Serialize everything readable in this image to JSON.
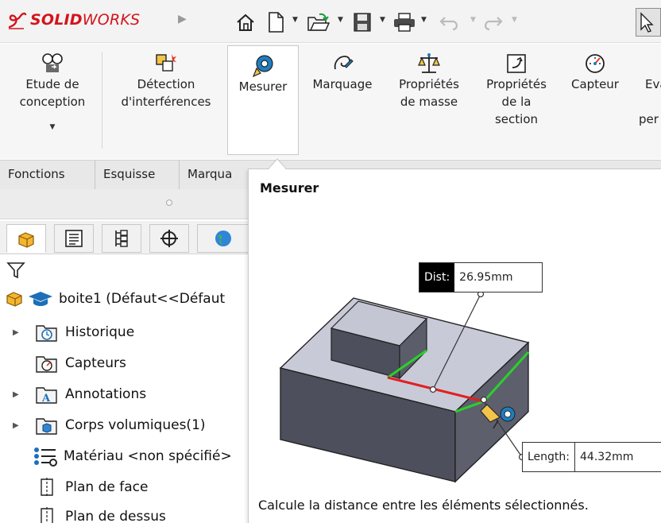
{
  "app": {
    "logo_prefix": "SOLID",
    "logo_suffix": "WORKS",
    "brand_color": "#d3141c"
  },
  "quick_access": {
    "items": [
      "home-icon",
      "new-document-icon",
      "open-folder-icon",
      "save-icon",
      "print-icon",
      "undo-icon",
      "redo-icon",
      "select-pointer-icon"
    ]
  },
  "ribbon": {
    "buttons": [
      {
        "label": "Etude de conception",
        "icon": "design-study-icon"
      },
      {
        "label": "Détection d'interférences",
        "icon": "interference-detection-icon"
      },
      {
        "label": "Mesurer",
        "icon": "measure-tape-icon",
        "active": true
      },
      {
        "label": "Marquage",
        "icon": "markup-icon"
      },
      {
        "label": "Propriétés de masse",
        "icon": "balance-scale-icon"
      },
      {
        "label": "Propriétés de la section",
        "icon": "section-properties-icon"
      },
      {
        "label": "Capteur",
        "icon": "sensor-gauge-icon"
      },
      {
        "label": "Eva",
        "label_line3": "per",
        "icon": "evaluate-icon"
      }
    ]
  },
  "tabs": [
    {
      "label": "Fonctions"
    },
    {
      "label": "Esquisse"
    },
    {
      "label": "Marqua"
    }
  ],
  "feature_manager": {
    "panel_tabs": [
      "feature-tree-icon",
      "property-manager-icon",
      "configuration-manager-icon",
      "dimxpert-icon",
      "display-manager-icon"
    ],
    "filter_icon": "filter-funnel-icon",
    "root": {
      "label": "boite1  (Défaut<<Défaut"
    },
    "nodes": [
      {
        "label": "Historique",
        "expandable": true,
        "icon": "history-icon"
      },
      {
        "label": "Capteurs",
        "expandable": false,
        "icon": "sensors-icon"
      },
      {
        "label": "Annotations",
        "expandable": true,
        "icon": "annotations-icon"
      },
      {
        "label": "Corps volumiques(1)",
        "expandable": true,
        "icon": "solid-bodies-icon"
      },
      {
        "label": "Matériau <non spécifié>",
        "expandable": false,
        "icon": "material-icon"
      },
      {
        "label": "Plan de face",
        "expandable": false,
        "icon": "plane-icon"
      },
      {
        "label": "Plan de dessus",
        "expandable": false,
        "icon": "plane-icon"
      }
    ]
  },
  "tooltip": {
    "title": "Mesurer",
    "dist_key": "Dist:",
    "dist_value": "26.95mm",
    "length_key": "Length:",
    "length_value": "44.32mm",
    "description": "Calcule la distance entre les éléments sélectionnés."
  }
}
